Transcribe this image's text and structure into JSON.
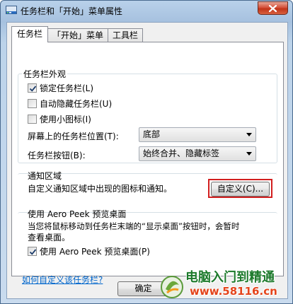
{
  "window": {
    "title": "任务栏和「开始」菜单属性",
    "close_symbol": "✕"
  },
  "tabs": [
    {
      "label": "任务栏",
      "active": true
    },
    {
      "label": "「开始」菜单",
      "active": false
    },
    {
      "label": "工具栏",
      "active": false
    }
  ],
  "appearance": {
    "title": "任务栏外观",
    "lock": {
      "label": "锁定任务栏(L)",
      "checked": true
    },
    "autohide": {
      "label": "自动隐藏任务栏(U)",
      "checked": false
    },
    "small_icons": {
      "label": "使用小图标(I)",
      "checked": false
    },
    "location_label": "屏幕上的任务栏位置(T):",
    "location_value": "底部",
    "buttons_label": "任务栏按钮(B):",
    "buttons_value": "始终合并、隐藏标签"
  },
  "notification": {
    "title": "通知区域",
    "description": "自定义通知区域中出现的图标和通知。",
    "customize_label": "自定义(C)..."
  },
  "aero": {
    "title": "使用 Aero Peek 预览桌面",
    "description_line1": "当您将鼠标移动到任务栏末端的“显示桌面”按钮时，会暂时",
    "description_line2": "查看桌面。",
    "checkbox": {
      "label": "使用 Aero Peek 预览桌面(P)",
      "checked": true
    }
  },
  "help_link": "如何自定义该任务栏?",
  "footer": {
    "ok_label": "确定"
  },
  "watermark": {
    "line1": "电脑入门到精通",
    "line2": "www.58116.cn"
  },
  "colors": {
    "highlight": "#d21f1f",
    "link": "#0066cc"
  }
}
